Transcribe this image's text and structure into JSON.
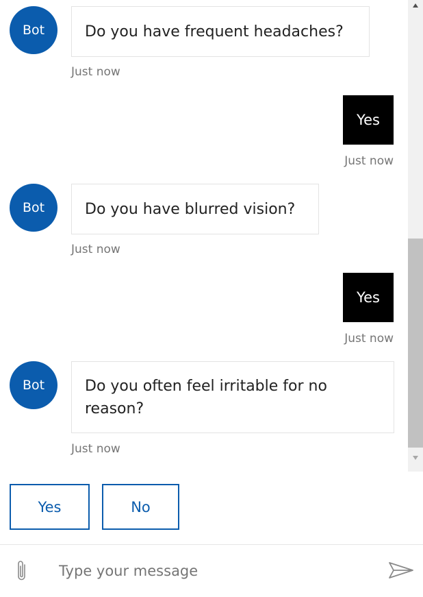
{
  "bot_avatar_label": "Bot",
  "messages": [
    {
      "from": "bot",
      "text": "Do you have frequent headaches?",
      "time": "Just now"
    },
    {
      "from": "user",
      "text": "Yes",
      "time": "Just now"
    },
    {
      "from": "bot",
      "text": "Do you have blurred vision?",
      "time": "Just now"
    },
    {
      "from": "user",
      "text": "Yes",
      "time": "Just now"
    },
    {
      "from": "bot",
      "text": "Do you often feel irritable for no reason?",
      "time": "Just now"
    }
  ],
  "suggested_actions": [
    "Yes",
    "No"
  ],
  "input": {
    "placeholder": "Type your message",
    "value": ""
  },
  "icons": {
    "attach": "paperclip-icon",
    "send": "send-icon",
    "scroll_up": "scroll-up-arrow-icon",
    "scroll_down": "scroll-down-arrow-icon"
  },
  "colors": {
    "accent": "#0b5cad",
    "user_bubble": "#000000",
    "timestamp": "#757575"
  }
}
